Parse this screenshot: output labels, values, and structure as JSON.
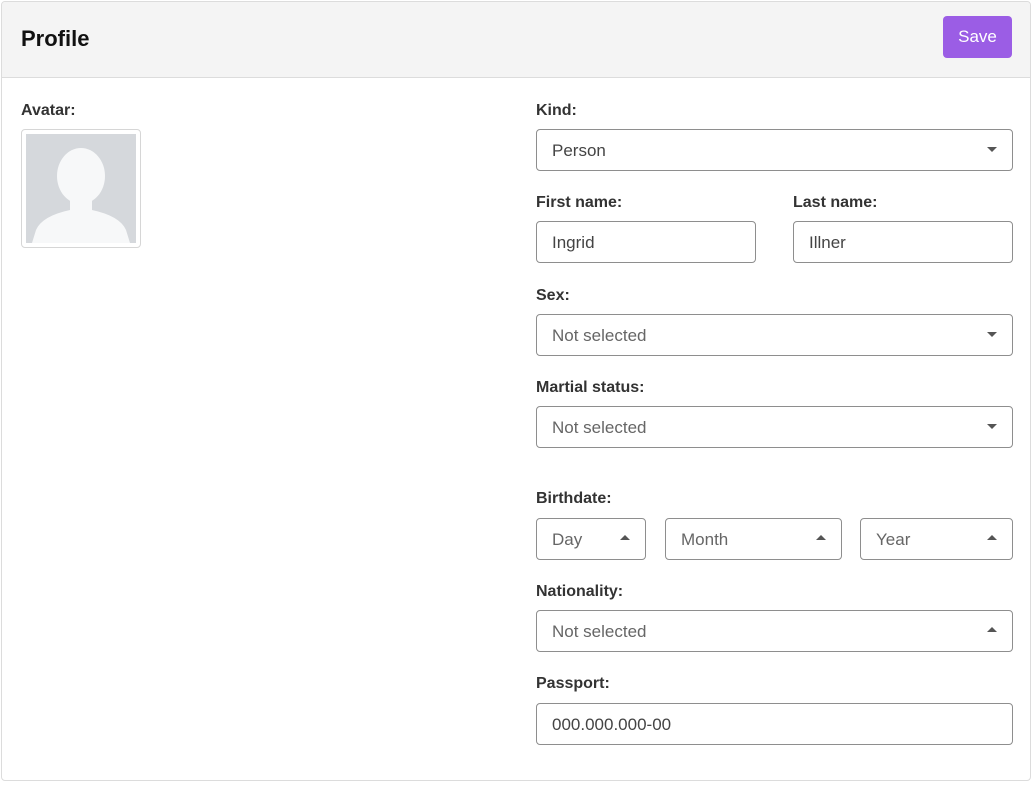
{
  "header": {
    "title": "Profile",
    "save_label": "Save"
  },
  "avatar": {
    "label": "Avatar:"
  },
  "kind": {
    "label": "Kind:",
    "value": "Person"
  },
  "first_name": {
    "label": "First name:",
    "value": "Ingrid"
  },
  "last_name": {
    "label": "Last name:",
    "value": "Illner"
  },
  "sex": {
    "label": "Sex:",
    "value": "Not selected"
  },
  "marital_status": {
    "label": "Martial status:",
    "value": "Not selected"
  },
  "birthdate": {
    "label": "Birthdate:",
    "day": "Day",
    "month": "Month",
    "year": "Year"
  },
  "nationality": {
    "label": "Nationality:",
    "value": "Not selected"
  },
  "passport": {
    "label": "Passport:",
    "value": "000.000.000-00"
  },
  "colors": {
    "accent": "#9b5de5",
    "header_bg": "#f4f4f4",
    "border": "#8e8e8e",
    "avatar_bg": "#d5d8dc"
  },
  "icons": {
    "select_caret_down": "caret-down-icon",
    "select_caret_up": "caret-up-icon",
    "avatar": "person-silhouette-icon"
  }
}
